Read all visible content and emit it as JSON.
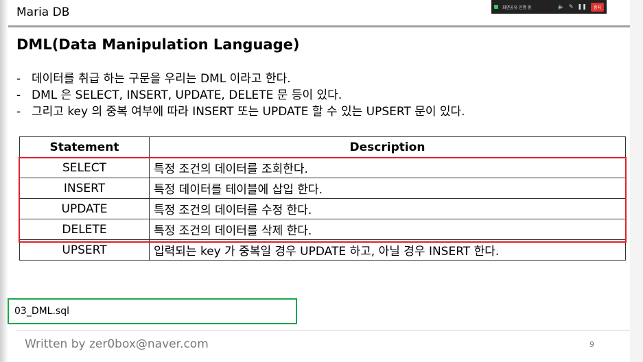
{
  "header": {
    "title": "Maria DB"
  },
  "share_bar": {
    "text": "화면공유 진행 중",
    "stop_label": "중지"
  },
  "section": {
    "title": "DML(Data Manipulation Language)"
  },
  "bullets": [
    "데이터를 취급 하는 구문을 우리는 DML 이라고 한다.",
    "DML 은 SELECT, INSERT, UPDATE, DELETE 문 등이 있다.",
    "그리고 key 의 중복 여부에 따라 INSERT 또는 UPDATE 할 수 있는 UPSERT 문이 있다."
  ],
  "table": {
    "headers": [
      "Statement",
      "Description"
    ],
    "rows": [
      [
        "SELECT",
        "특정 조건의 데이터를 조회한다."
      ],
      [
        "INSERT",
        "특정 데이터를 테이블에 삽입 한다."
      ],
      [
        "UPDATE",
        "특정 조건의 데이터를 수정 한다."
      ],
      [
        "DELETE",
        "특정 조건의 데이터를 삭제 한다."
      ],
      [
        "UPSERT",
        "입력되는 key 가 중복일 경우 UPDATE 하고, 아닐 경우 INSERT 한다."
      ]
    ]
  },
  "file_label": "03_DML.sql",
  "footer": {
    "text": "Written by zer0box@naver.com",
    "page": "9"
  },
  "colors": {
    "highlight_red": "#e0202a",
    "highlight_green": "#1aa84a"
  }
}
